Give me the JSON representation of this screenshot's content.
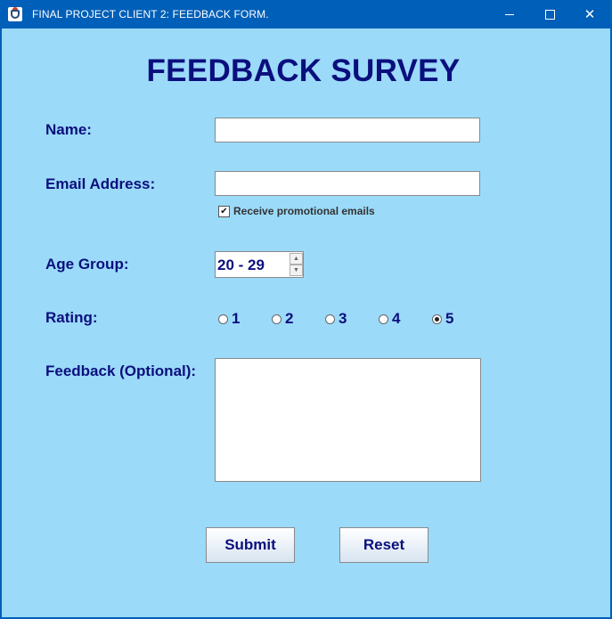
{
  "window": {
    "title": "FINAL PROJECT CLIENT 2: FEEDBACK FORM.",
    "controls": {
      "minimize": "—",
      "maximize": "☐",
      "close": "✕"
    },
    "titlebar_color": "#005fb8"
  },
  "form": {
    "heading": "FEEDBACK SURVEY",
    "background_color": "#9bdaf9",
    "text_color": "#0b0f7d",
    "name": {
      "label": "Name:",
      "value": ""
    },
    "email": {
      "label": "Email Address:",
      "value": "",
      "promo_checkbox": {
        "label": "Receive promotional emails",
        "checked": true,
        "mark": "✔"
      }
    },
    "age_group": {
      "label": "Age Group:",
      "value": "20 - 29",
      "up": "▲",
      "down": "▼"
    },
    "rating": {
      "label": "Rating:",
      "options": [
        "1",
        "2",
        "3",
        "4",
        "5"
      ],
      "selected": "5"
    },
    "feedback": {
      "label": "Feedback (Optional):",
      "value": ""
    },
    "buttons": {
      "submit": "Submit",
      "reset": "Reset"
    }
  }
}
